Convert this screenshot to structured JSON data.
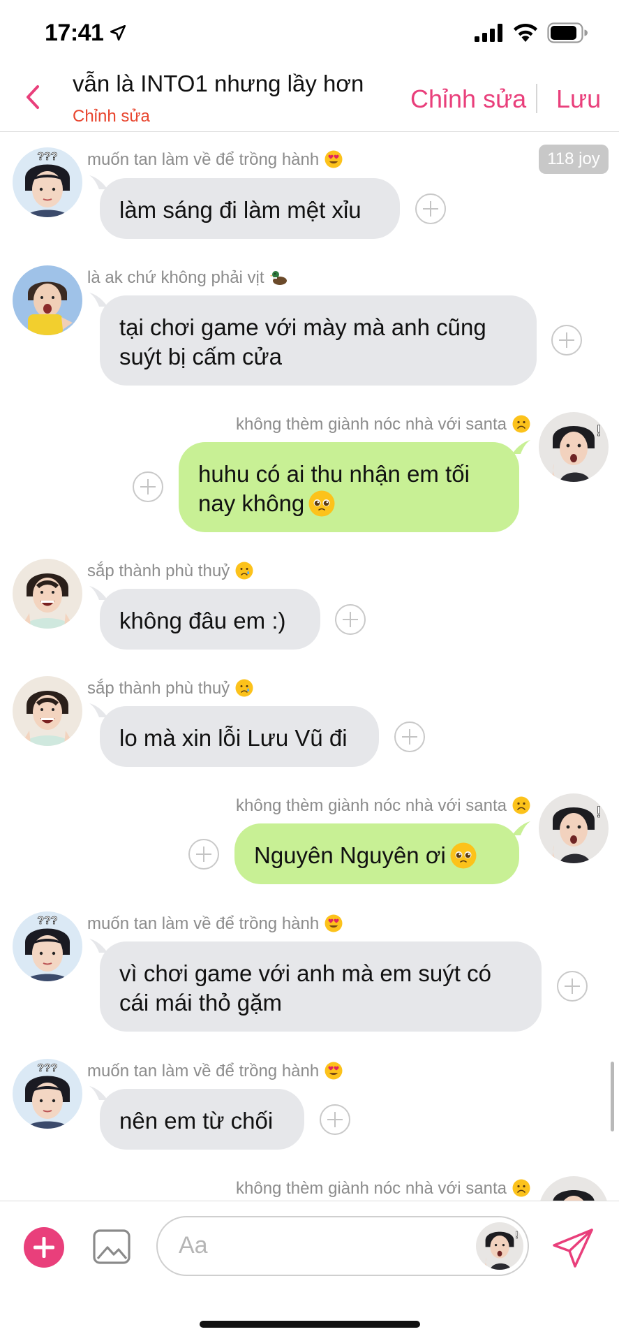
{
  "status_bar": {
    "time": "17:41",
    "icons": [
      "location-arrow-icon",
      "cellular-signal-icon",
      "wifi-icon",
      "battery-icon"
    ]
  },
  "header": {
    "title": "vẫn là INTO1 nhưng lầy hơn",
    "title_edit_label": "Chỉnh sửa",
    "edit_label": "Chỉnh sửa",
    "save_label": "Lưu",
    "back_icon": "chevron-left-icon"
  },
  "joy_badge": "118 joy",
  "messages": [
    {
      "side": "in",
      "sender": "muốn tan làm về để trồng hành",
      "sender_emoji": "heart-eyes",
      "text": "làm sáng đi làm mệt xỉu",
      "avatar": "avatar-a"
    },
    {
      "side": "in",
      "sender": "là ak chứ không phải vịt",
      "sender_emoji": "duck",
      "text": "tại chơi game với mày mà anh cũng suýt bị cấm cửa",
      "avatar": "avatar-b"
    },
    {
      "side": "out",
      "sender": "không thèm giành nóc nhà với santa",
      "sender_emoji": "frowning",
      "text": "huhu có ai thu nhận em tối nay không",
      "text_emoji": "pleading",
      "avatar": "avatar-d"
    },
    {
      "side": "in",
      "sender": "sắp thành phù thuỷ",
      "sender_emoji": "crying",
      "text": "không đâu em :)",
      "avatar": "avatar-c"
    },
    {
      "side": "in",
      "sender": "sắp thành phù thuỷ",
      "sender_emoji": "crying",
      "text": "lo mà xin lỗi Lưu Vũ đi",
      "avatar": "avatar-c"
    },
    {
      "side": "out",
      "sender": "không thèm giành nóc nhà với santa",
      "sender_emoji": "frowning",
      "text": "Nguyên Nguyên ơi",
      "text_emoji": "pleading",
      "avatar": "avatar-d"
    },
    {
      "side": "in",
      "sender": "muốn tan làm về để trồng hành",
      "sender_emoji": "heart-eyes",
      "text": "vì chơi game với anh mà em suýt có cái mái thỏ gặm",
      "avatar": "avatar-a"
    },
    {
      "side": "in",
      "sender": "muốn tan làm về để trồng hành",
      "sender_emoji": "heart-eyes",
      "text": "nên em từ chối",
      "avatar": "avatar-a"
    },
    {
      "side": "out",
      "sender": "không thèm giành nóc nhà với santa",
      "sender_emoji": "frowning",
      "avatar": "avatar-d"
    }
  ],
  "avatar_overlay": {
    "question_marks": "???",
    "exclamation": "!"
  },
  "input_bar": {
    "placeholder": "Aa",
    "icons": [
      "plus-icon",
      "image-icon",
      "send-icon"
    ]
  },
  "colors": {
    "accent": "#e93f7b",
    "title_edit": "#e8452e",
    "incoming_bubble": "#e6e7ea",
    "outgoing_bubble": "#c8f095",
    "sender_text": "#8c8c8c"
  }
}
